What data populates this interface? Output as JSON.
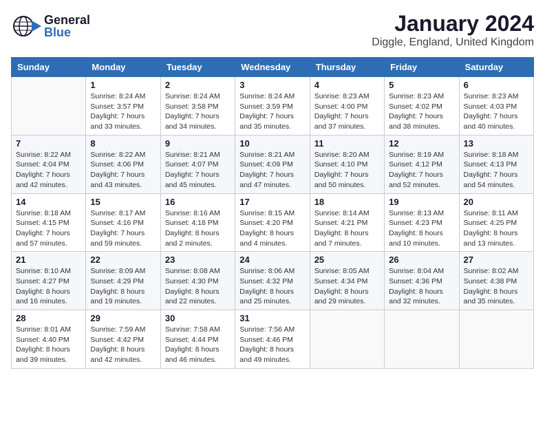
{
  "header": {
    "logo_general": "General",
    "logo_blue": "Blue",
    "month": "January 2024",
    "location": "Diggle, England, United Kingdom"
  },
  "days_of_week": [
    "Sunday",
    "Monday",
    "Tuesday",
    "Wednesday",
    "Thursday",
    "Friday",
    "Saturday"
  ],
  "weeks": [
    [
      {
        "day": "",
        "sunrise": "",
        "sunset": "",
        "daylight": ""
      },
      {
        "day": "1",
        "sunrise": "Sunrise: 8:24 AM",
        "sunset": "Sunset: 3:57 PM",
        "daylight": "Daylight: 7 hours and 33 minutes."
      },
      {
        "day": "2",
        "sunrise": "Sunrise: 8:24 AM",
        "sunset": "Sunset: 3:58 PM",
        "daylight": "Daylight: 7 hours and 34 minutes."
      },
      {
        "day": "3",
        "sunrise": "Sunrise: 8:24 AM",
        "sunset": "Sunset: 3:59 PM",
        "daylight": "Daylight: 7 hours and 35 minutes."
      },
      {
        "day": "4",
        "sunrise": "Sunrise: 8:23 AM",
        "sunset": "Sunset: 4:00 PM",
        "daylight": "Daylight: 7 hours and 37 minutes."
      },
      {
        "day": "5",
        "sunrise": "Sunrise: 8:23 AM",
        "sunset": "Sunset: 4:02 PM",
        "daylight": "Daylight: 7 hours and 38 minutes."
      },
      {
        "day": "6",
        "sunrise": "Sunrise: 8:23 AM",
        "sunset": "Sunset: 4:03 PM",
        "daylight": "Daylight: 7 hours and 40 minutes."
      }
    ],
    [
      {
        "day": "7",
        "sunrise": "Sunrise: 8:22 AM",
        "sunset": "Sunset: 4:04 PM",
        "daylight": "Daylight: 7 hours and 42 minutes."
      },
      {
        "day": "8",
        "sunrise": "Sunrise: 8:22 AM",
        "sunset": "Sunset: 4:06 PM",
        "daylight": "Daylight: 7 hours and 43 minutes."
      },
      {
        "day": "9",
        "sunrise": "Sunrise: 8:21 AM",
        "sunset": "Sunset: 4:07 PM",
        "daylight": "Daylight: 7 hours and 45 minutes."
      },
      {
        "day": "10",
        "sunrise": "Sunrise: 8:21 AM",
        "sunset": "Sunset: 4:09 PM",
        "daylight": "Daylight: 7 hours and 47 minutes."
      },
      {
        "day": "11",
        "sunrise": "Sunrise: 8:20 AM",
        "sunset": "Sunset: 4:10 PM",
        "daylight": "Daylight: 7 hours and 50 minutes."
      },
      {
        "day": "12",
        "sunrise": "Sunrise: 8:19 AM",
        "sunset": "Sunset: 4:12 PM",
        "daylight": "Daylight: 7 hours and 52 minutes."
      },
      {
        "day": "13",
        "sunrise": "Sunrise: 8:18 AM",
        "sunset": "Sunset: 4:13 PM",
        "daylight": "Daylight: 7 hours and 54 minutes."
      }
    ],
    [
      {
        "day": "14",
        "sunrise": "Sunrise: 8:18 AM",
        "sunset": "Sunset: 4:15 PM",
        "daylight": "Daylight: 7 hours and 57 minutes."
      },
      {
        "day": "15",
        "sunrise": "Sunrise: 8:17 AM",
        "sunset": "Sunset: 4:16 PM",
        "daylight": "Daylight: 7 hours and 59 minutes."
      },
      {
        "day": "16",
        "sunrise": "Sunrise: 8:16 AM",
        "sunset": "Sunset: 4:18 PM",
        "daylight": "Daylight: 8 hours and 2 minutes."
      },
      {
        "day": "17",
        "sunrise": "Sunrise: 8:15 AM",
        "sunset": "Sunset: 4:20 PM",
        "daylight": "Daylight: 8 hours and 4 minutes."
      },
      {
        "day": "18",
        "sunrise": "Sunrise: 8:14 AM",
        "sunset": "Sunset: 4:21 PM",
        "daylight": "Daylight: 8 hours and 7 minutes."
      },
      {
        "day": "19",
        "sunrise": "Sunrise: 8:13 AM",
        "sunset": "Sunset: 4:23 PM",
        "daylight": "Daylight: 8 hours and 10 minutes."
      },
      {
        "day": "20",
        "sunrise": "Sunrise: 8:11 AM",
        "sunset": "Sunset: 4:25 PM",
        "daylight": "Daylight: 8 hours and 13 minutes."
      }
    ],
    [
      {
        "day": "21",
        "sunrise": "Sunrise: 8:10 AM",
        "sunset": "Sunset: 4:27 PM",
        "daylight": "Daylight: 8 hours and 16 minutes."
      },
      {
        "day": "22",
        "sunrise": "Sunrise: 8:09 AM",
        "sunset": "Sunset: 4:29 PM",
        "daylight": "Daylight: 8 hours and 19 minutes."
      },
      {
        "day": "23",
        "sunrise": "Sunrise: 8:08 AM",
        "sunset": "Sunset: 4:30 PM",
        "daylight": "Daylight: 8 hours and 22 minutes."
      },
      {
        "day": "24",
        "sunrise": "Sunrise: 8:06 AM",
        "sunset": "Sunset: 4:32 PM",
        "daylight": "Daylight: 8 hours and 25 minutes."
      },
      {
        "day": "25",
        "sunrise": "Sunrise: 8:05 AM",
        "sunset": "Sunset: 4:34 PM",
        "daylight": "Daylight: 8 hours and 29 minutes."
      },
      {
        "day": "26",
        "sunrise": "Sunrise: 8:04 AM",
        "sunset": "Sunset: 4:36 PM",
        "daylight": "Daylight: 8 hours and 32 minutes."
      },
      {
        "day": "27",
        "sunrise": "Sunrise: 8:02 AM",
        "sunset": "Sunset: 4:38 PM",
        "daylight": "Daylight: 8 hours and 35 minutes."
      }
    ],
    [
      {
        "day": "28",
        "sunrise": "Sunrise: 8:01 AM",
        "sunset": "Sunset: 4:40 PM",
        "daylight": "Daylight: 8 hours and 39 minutes."
      },
      {
        "day": "29",
        "sunrise": "Sunrise: 7:59 AM",
        "sunset": "Sunset: 4:42 PM",
        "daylight": "Daylight: 8 hours and 42 minutes."
      },
      {
        "day": "30",
        "sunrise": "Sunrise: 7:58 AM",
        "sunset": "Sunset: 4:44 PM",
        "daylight": "Daylight: 8 hours and 46 minutes."
      },
      {
        "day": "31",
        "sunrise": "Sunrise: 7:56 AM",
        "sunset": "Sunset: 4:46 PM",
        "daylight": "Daylight: 8 hours and 49 minutes."
      },
      {
        "day": "",
        "sunrise": "",
        "sunset": "",
        "daylight": ""
      },
      {
        "day": "",
        "sunrise": "",
        "sunset": "",
        "daylight": ""
      },
      {
        "day": "",
        "sunrise": "",
        "sunset": "",
        "daylight": ""
      }
    ]
  ]
}
